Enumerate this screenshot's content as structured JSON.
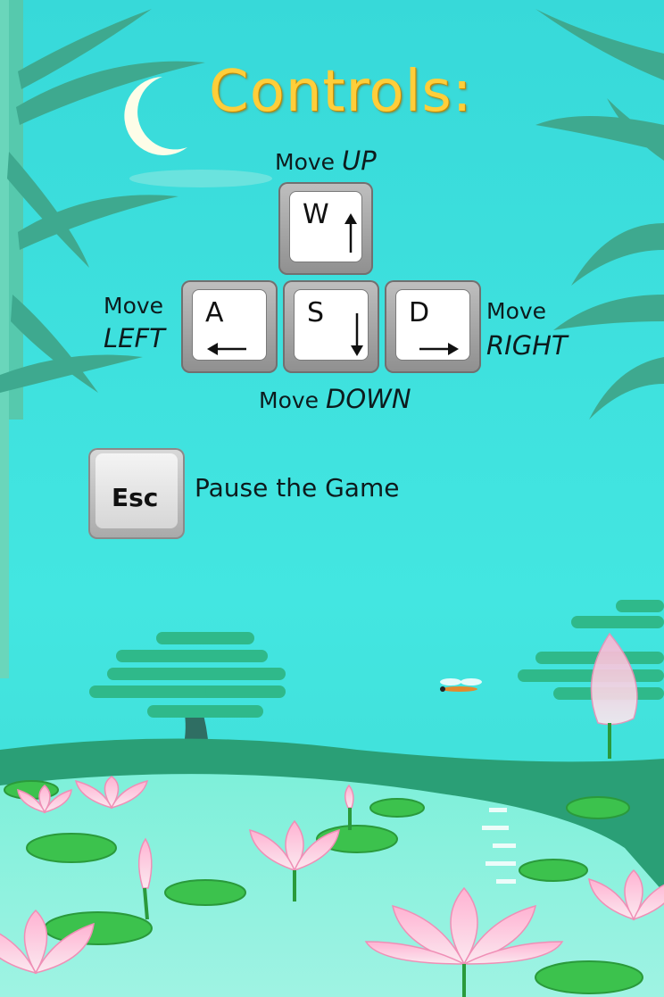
{
  "screen": {
    "title": "Controls:"
  },
  "controls": {
    "up": {
      "verb": "Move",
      "dir": "UP",
      "key": "W"
    },
    "left": {
      "verb": "Move",
      "dir": "LEFT",
      "key": "A"
    },
    "down": {
      "verb": "Move",
      "dir": "DOWN",
      "key": "S"
    },
    "right": {
      "verb": "Move",
      "dir": "RIGHT",
      "key": "D"
    },
    "pause": {
      "key": "Esc",
      "action": "Pause the Game"
    }
  },
  "colors": {
    "sky": "#3ee3e0",
    "title": "#ffce3a",
    "leaf": "#2fb98a",
    "lotus": "#f6a9c9"
  },
  "icons": [
    "moon-icon",
    "bamboo-icon",
    "tree-icon",
    "lotus-icon",
    "dragonfly-icon",
    "arrow-up-icon",
    "arrow-left-icon",
    "arrow-down-icon",
    "arrow-right-icon"
  ]
}
